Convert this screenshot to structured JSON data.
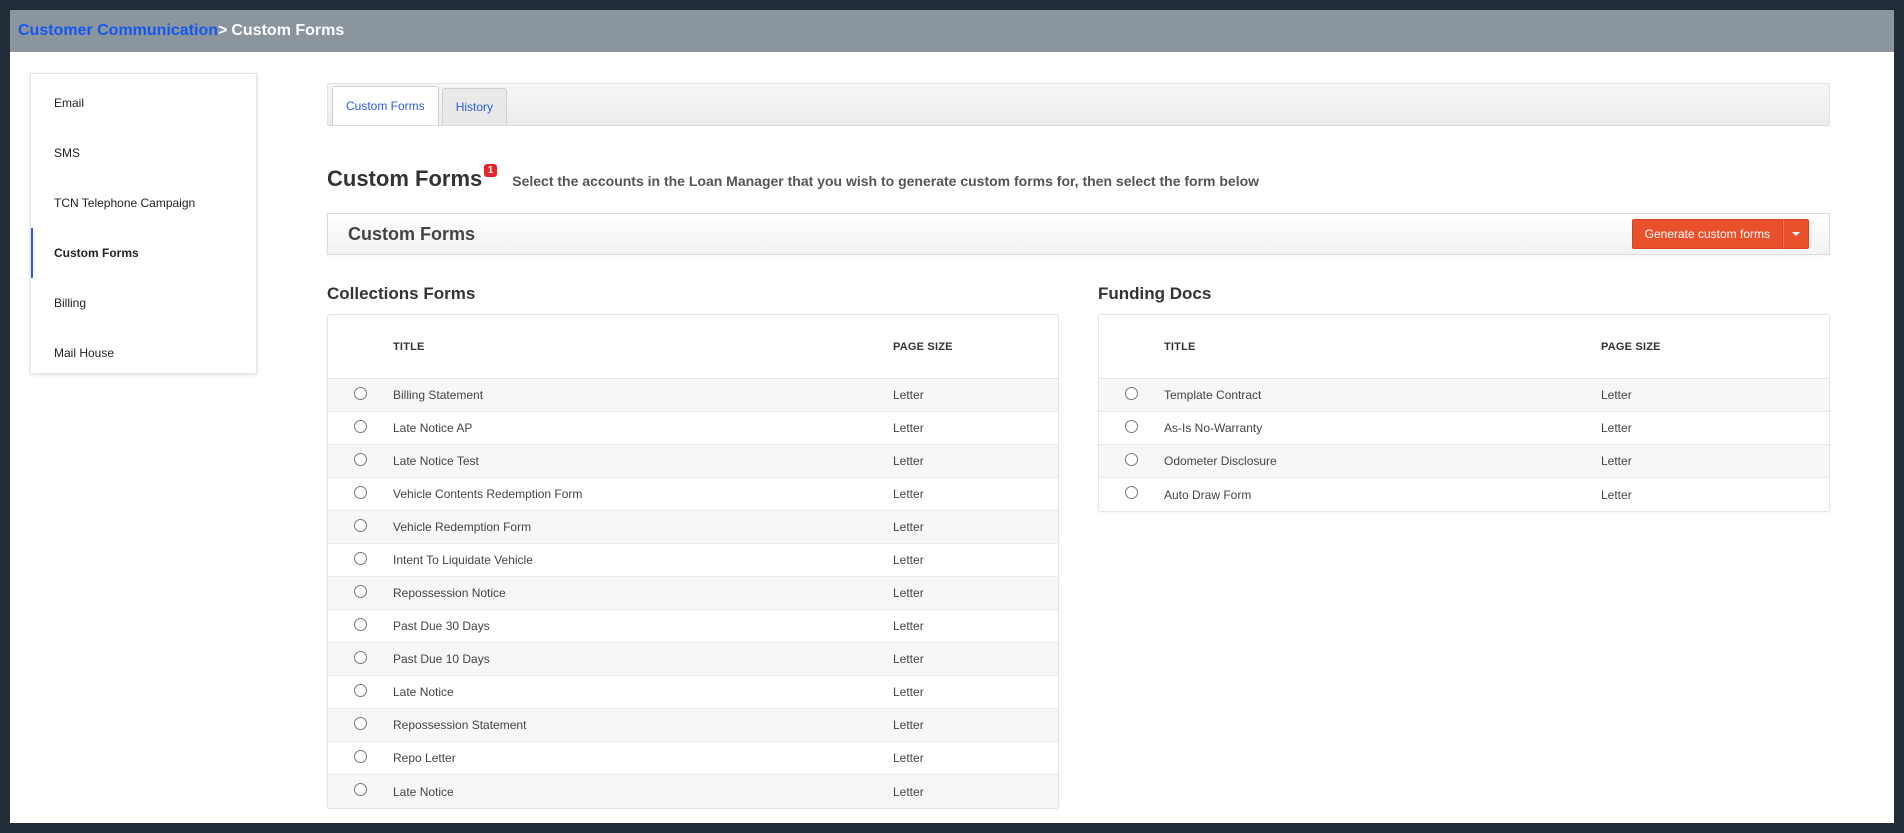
{
  "breadcrumb": {
    "parent": "Customer Communication",
    "separator": ">",
    "current": "Custom Forms"
  },
  "sidebar": {
    "items": [
      {
        "label": "Email"
      },
      {
        "label": "SMS"
      },
      {
        "label": "TCN Telephone Campaign"
      },
      {
        "label": "Custom Forms",
        "active": true
      },
      {
        "label": "Billing"
      },
      {
        "label": "Mail House"
      }
    ]
  },
  "tabs": [
    {
      "label": "Custom Forms",
      "active": true
    },
    {
      "label": "History"
    }
  ],
  "heading": {
    "title": "Custom Forms",
    "badge": "1",
    "subtitle": "Select the accounts in the Loan Manager that you wish to generate custom forms for, then select the form below"
  },
  "panel": {
    "title": "Custom Forms",
    "generate_label": "Generate custom forms"
  },
  "colors": {
    "accent_blue": "#2d5be3",
    "button_orange": "#e8512b",
    "topbar": "#8a959d",
    "badge_red": "#e8242a"
  },
  "collections": {
    "title": "Collections Forms",
    "headers": {
      "title": "TITLE",
      "page_size": "PAGE SIZE"
    },
    "rows": [
      {
        "title": "Billing Statement",
        "size": "Letter"
      },
      {
        "title": "Late Notice AP",
        "size": "Letter"
      },
      {
        "title": "Late Notice Test",
        "size": "Letter"
      },
      {
        "title": "Vehicle Contents Redemption Form",
        "size": "Letter"
      },
      {
        "title": "Vehicle Redemption Form",
        "size": "Letter"
      },
      {
        "title": "Intent To Liquidate Vehicle",
        "size": "Letter"
      },
      {
        "title": "Repossession Notice",
        "size": "Letter"
      },
      {
        "title": "Past Due 30 Days",
        "size": "Letter"
      },
      {
        "title": "Past Due 10 Days",
        "size": "Letter"
      },
      {
        "title": "Late Notice",
        "size": "Letter"
      },
      {
        "title": "Repossession Statement",
        "size": "Letter"
      },
      {
        "title": "Repo Letter",
        "size": "Letter"
      },
      {
        "title": "Late Notice",
        "size": "Letter"
      }
    ]
  },
  "funding": {
    "title": "Funding Docs",
    "headers": {
      "title": "TITLE",
      "page_size": "PAGE SIZE"
    },
    "rows": [
      {
        "title": "Template Contract",
        "size": "Letter"
      },
      {
        "title": "As-Is No-Warranty",
        "size": "Letter"
      },
      {
        "title": "Odometer Disclosure",
        "size": "Letter"
      },
      {
        "title": "Auto Draw Form",
        "size": "Letter"
      }
    ]
  }
}
